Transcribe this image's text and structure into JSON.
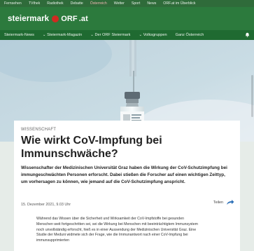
{
  "topnav": {
    "items": [
      "Fernsehen",
      "TVthek",
      "Radiothek",
      "Debatte",
      "Österreich",
      "Wetter",
      "Sport",
      "News",
      "ORF.at im Überblick"
    ]
  },
  "brand": {
    "name": "steiermark",
    "orf": "ORF",
    "suffix": ".at"
  },
  "subnav": {
    "items": [
      "Steiermark-News",
      "Steiermark-Magazin",
      "Der ORF Steiermark",
      "Volksgruppen",
      "Ganz Österreich"
    ]
  },
  "article": {
    "kicker": "WISSENSCHAFT",
    "title": "Wie wirkt CoV-Impfung bei Immunschwäche?",
    "lead": "Wissenschafter der Medizinischen Universität Graz haben die Wirkung der CoV-Schutzimpfung bei immungeschwächten Personen erforscht. Dabei stießen die Forscher auf einen wichtigen Zeittyp, um vorhersagen zu können, wie jemand auf die CoV-Schutzimpfung anspricht.",
    "date": "15. Dezember 2021, 9.03 Uhr",
    "share": "Teilen",
    "body": "Während das Wissen über die Sicherheit und Wirksamkeit der CoV-Impfstoffe bei gesunden Menschen weit fortgeschritten sei, sei die Wirkung bei Menschen mit beeinträchtigtem Immunsystem noch unvollständig erforscht, hieß es in einer Aussendung der Medizinischen Universität Graz. Eine Studie der Meduni widmete sich der Frage, wie die Immunantwort nach einer CoV-Impfung bei immunsupprimierten"
  },
  "colors": {
    "topbar": "#2f6b3a",
    "brandbar": "#2c7a3d",
    "navbar": "#1f6a31",
    "orf_red": "#d12a21"
  }
}
